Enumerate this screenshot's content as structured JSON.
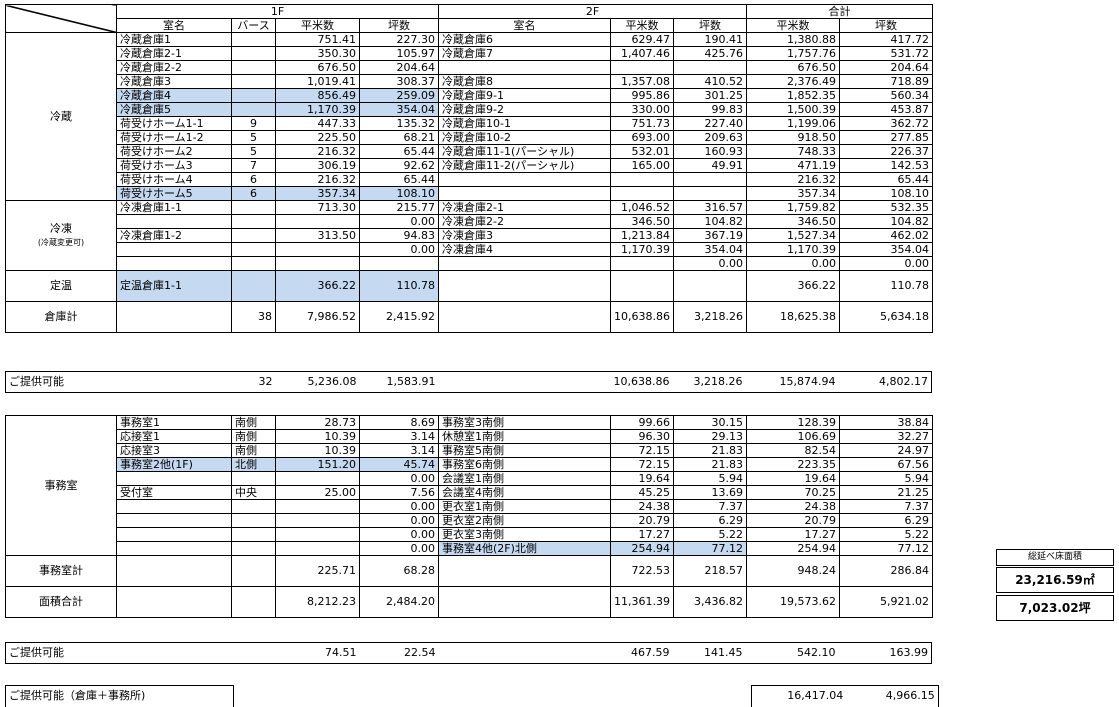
{
  "headers": {
    "floor1": "1F",
    "floor2": "2F",
    "total": "合計",
    "room": "室名",
    "berth": "バース",
    "sqm": "平米数",
    "tsubo": "坪数"
  },
  "reizo": {
    "label": "冷蔵",
    "rows": [
      {
        "n1": "冷蔵倉庫1",
        "b": "",
        "s1": "751.41",
        "t1": "227.30",
        "n2": "冷蔵倉庫6",
        "s2": "629.47",
        "t2": "190.41",
        "st": "1,380.88",
        "tt": "417.72"
      },
      {
        "n1": "冷蔵倉庫2-1",
        "b": "",
        "s1": "350.30",
        "t1": "105.97",
        "n2": "冷蔵倉庫7",
        "s2": "1,407.46",
        "t2": "425.76",
        "st": "1,757.76",
        "tt": "531.72"
      },
      {
        "n1": "冷蔵倉庫2-2",
        "b": "",
        "s1": "676.50",
        "t1": "204.64",
        "n2": "",
        "s2": "",
        "t2": "",
        "st": "676.50",
        "tt": "204.64"
      },
      {
        "n1": "冷蔵倉庫3",
        "b": "",
        "s1": "1,019.41",
        "t1": "308.37",
        "n2": "冷蔵倉庫8",
        "s2": "1,357.08",
        "t2": "410.52",
        "st": "2,376.49",
        "tt": "718.89"
      },
      {
        "n1": "冷蔵倉庫4",
        "b": "",
        "s1": "856.49",
        "t1": "259.09",
        "n2": "冷蔵倉庫9-1",
        "s2": "995.86",
        "t2": "301.25",
        "st": "1,852.35",
        "tt": "560.34"
      },
      {
        "n1": "冷蔵倉庫5",
        "b": "",
        "s1": "1,170.39",
        "t1": "354.04",
        "n2": "冷蔵倉庫9-2",
        "s2": "330.00",
        "t2": "99.83",
        "st": "1,500.39",
        "tt": "453.87"
      },
      {
        "n1": "荷受けホーム1-1",
        "b": "9",
        "s1": "447.33",
        "t1": "135.32",
        "n2": "冷蔵倉庫10-1",
        "s2": "751.73",
        "t2": "227.40",
        "st": "1,199.06",
        "tt": "362.72"
      },
      {
        "n1": "荷受けホーム1-2",
        "b": "5",
        "s1": "225.50",
        "t1": "68.21",
        "n2": "冷蔵倉庫10-2",
        "s2": "693.00",
        "t2": "209.63",
        "st": "918.50",
        "tt": "277.85"
      },
      {
        "n1": "荷受けホーム2",
        "b": "5",
        "s1": "216.32",
        "t1": "65.44",
        "n2": "冷蔵倉庫11-1(パーシャル)",
        "s2": "532.01",
        "t2": "160.93",
        "st": "748.33",
        "tt": "226.37"
      },
      {
        "n1": "荷受けホーム3",
        "b": "7",
        "s1": "306.19",
        "t1": "92.62",
        "n2": "冷蔵倉庫11-2(パーシャル)",
        "s2": "165.00",
        "t2": "49.91",
        "st": "471.19",
        "tt": "142.53"
      },
      {
        "n1": "荷受けホーム4",
        "b": "6",
        "s1": "216.32",
        "t1": "65.44",
        "n2": "",
        "s2": "",
        "t2": "",
        "st": "216.32",
        "tt": "65.44"
      },
      {
        "n1": "荷受けホーム5",
        "b": "6",
        "s1": "357.34",
        "t1": "108.10",
        "n2": "",
        "s2": "",
        "t2": "",
        "st": "357.34",
        "tt": "108.10"
      }
    ]
  },
  "reito": {
    "label": "冷凍",
    "sublabel": "(冷蔵変更可)",
    "rows": [
      {
        "n1": "冷凍倉庫1-1",
        "b": "",
        "s1": "713.30",
        "t1": "215.77",
        "n2": "冷凍倉庫2-1",
        "s2": "1,046.52",
        "t2": "316.57",
        "st": "1,759.82",
        "tt": "532.35"
      },
      {
        "n1": "",
        "b": "",
        "s1": "",
        "t1": "0.00",
        "n2": "冷凍倉庫2-2",
        "s2": "346.50",
        "t2": "104.82",
        "st": "346.50",
        "tt": "104.82"
      },
      {
        "n1": "冷凍倉庫1-2",
        "b": "",
        "s1": "313.50",
        "t1": "94.83",
        "n2": "冷凍倉庫3",
        "s2": "1,213.84",
        "t2": "367.19",
        "st": "1,527.34",
        "tt": "462.02"
      },
      {
        "n1": "",
        "b": "",
        "s1": "",
        "t1": "0.00",
        "n2": "冷凍倉庫4",
        "s2": "1,170.39",
        "t2": "354.04",
        "st": "1,170.39",
        "tt": "354.04"
      },
      {
        "n1": "",
        "b": "",
        "s1": "",
        "t1": "",
        "n2": "",
        "s2": "",
        "t2": "0.00",
        "st": "0.00",
        "tt": "0.00"
      }
    ]
  },
  "teion": {
    "label": "定温",
    "n1": "定温倉庫1-1",
    "s1": "366.22",
    "t1": "110.78",
    "st": "366.22",
    "tt": "110.78"
  },
  "soko_total": {
    "label": "倉庫計",
    "b": "38",
    "s1": "7,986.52",
    "t1": "2,415.92",
    "s2": "10,638.86",
    "t2": "3,218.26",
    "st": "18,625.38",
    "tt": "5,634.18"
  },
  "available1": {
    "label": "ご提供可能",
    "b": "32",
    "s1": "5,236.08",
    "t1": "1,583.91",
    "s2": "10,638.86",
    "t2": "3,218.26",
    "st": "15,874.94",
    "tt": "4,802.17"
  },
  "office": {
    "label": "事務室",
    "rows": [
      {
        "n1": "事務室1",
        "b": "南側",
        "s1": "28.73",
        "t1": "8.69",
        "n2": "事務室3南側",
        "s2": "99.66",
        "t2": "30.15",
        "st": "128.39",
        "tt": "38.84"
      },
      {
        "n1": "応接室1",
        "b": "南側",
        "s1": "10.39",
        "t1": "3.14",
        "n2": "休憩室1南側",
        "s2": "96.30",
        "t2": "29.13",
        "st": "106.69",
        "tt": "32.27"
      },
      {
        "n1": "応接室3",
        "b": "南側",
        "s1": "10.39",
        "t1": "3.14",
        "n2": "事務室5南側",
        "s2": "72.15",
        "t2": "21.83",
        "st": "82.54",
        "tt": "24.97"
      },
      {
        "n1": "事務室2他(1F)",
        "b": "北側",
        "s1": "151.20",
        "t1": "45.74",
        "n2": "事務室6南側",
        "s2": "72.15",
        "t2": "21.83",
        "st": "223.35",
        "tt": "67.56"
      },
      {
        "n1": "",
        "b": "",
        "s1": "",
        "t1": "0.00",
        "n2": "会議室1南側",
        "s2": "19.64",
        "t2": "5.94",
        "st": "19.64",
        "tt": "5.94"
      },
      {
        "n1": "受付室",
        "b": "中央",
        "s1": "25.00",
        "t1": "7.56",
        "n2": "会議室4南側",
        "s2": "45.25",
        "t2": "13.69",
        "st": "70.25",
        "tt": "21.25"
      },
      {
        "n1": "",
        "b": "",
        "s1": "",
        "t1": "0.00",
        "n2": "更衣室1南側",
        "s2": "24.38",
        "t2": "7.37",
        "st": "24.38",
        "tt": "7.37"
      },
      {
        "n1": "",
        "b": "",
        "s1": "",
        "t1": "0.00",
        "n2": "更衣室2南側",
        "s2": "20.79",
        "t2": "6.29",
        "st": "20.79",
        "tt": "6.29"
      },
      {
        "n1": "",
        "b": "",
        "s1": "",
        "t1": "0.00",
        "n2": "更衣室3南側",
        "s2": "17.27",
        "t2": "5.22",
        "st": "17.27",
        "tt": "5.22"
      },
      {
        "n1": "",
        "b": "",
        "s1": "",
        "t1": "0.00",
        "n2": "事務室4他(2F)北側",
        "s2": "254.94",
        "t2": "77.12",
        "st": "254.94",
        "tt": "77.12"
      }
    ]
  },
  "office_total": {
    "label": "事務室計",
    "s1": "225.71",
    "t1": "68.28",
    "s2": "722.53",
    "t2": "218.57",
    "st": "948.24",
    "tt": "286.84"
  },
  "area_total": {
    "label": "面積合計",
    "s1": "8,212.23",
    "t1": "2,484.20",
    "s2": "11,361.39",
    "t2": "3,436.82",
    "st": "19,573.62",
    "tt": "5,921.02"
  },
  "available2": {
    "label": "ご提供可能",
    "s1": "74.51",
    "t1": "22.54",
    "s2": "467.59",
    "t2": "141.45",
    "st": "542.10",
    "tt": "163.99"
  },
  "available3": {
    "label": "ご提供可能（倉庫＋事務所)",
    "st": "16,417.04",
    "tt": "4,966.15"
  },
  "summary": {
    "title": "総延べ床面積",
    "sqm": "23,216.59㎡",
    "tsubo": "7,023.02坪"
  }
}
